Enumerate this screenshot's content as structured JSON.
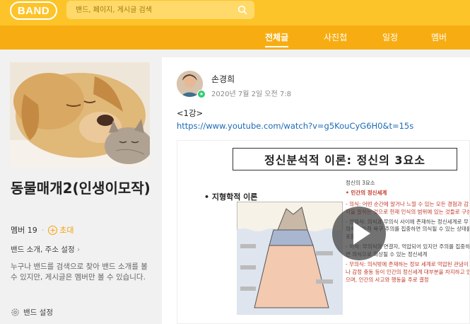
{
  "header": {
    "logo_text": "BAND",
    "search_placeholder": "밴드, 페이지, 게시글 검색",
    "brand_color": "#fdc42a",
    "tab_bar_color": "#f7ad12"
  },
  "tabs": [
    {
      "label": "전체글",
      "active": true
    },
    {
      "label": "사진첩",
      "active": false
    },
    {
      "label": "일정",
      "active": false
    },
    {
      "label": "멤버",
      "active": false
    }
  ],
  "band": {
    "name": "동물매개2(인생이모작)",
    "members_label": "멤버",
    "members_count": "19",
    "invite_label": "초대",
    "settings_link": "밴드 소개, 주소 설정",
    "description": "누구나 밴드를 검색으로 찾아 밴드 소개를 볼 수 있지만, 게시글은 멤버만 볼 수 있습니다.",
    "band_settings": "밴드 설정"
  },
  "post": {
    "author": "손경희",
    "date": "2020년 7월 2일 오전 7:8",
    "text": "<1강>",
    "link": "https://www.youtube.com/watch?v=g5KouCyG6H0&t=15s",
    "video": {
      "slide_title": "정신분석적 이론: 정신의 3요소",
      "slide_subtitle": "• 지형학적 이론",
      "slide_heading": "정신의 3요소",
      "slide_section": "• 인간의 정신세계",
      "slide_items": [
        "- 의식: 어떤 순간에 알거나 느낄 수 있는 모든 경험과 감각을 말하는 것으로 현재 인식의 범위에 있는 것들로 구성",
        "- 전의식: 의식과 무의식 사이에 존재하는 정신세계로 무의식 본능적 욕구 주의를 집중하면 의식될 수 있는 상태를 포함",
        "- 이식: 무의식의 연결자, 억압되어 있지만 주의를 집중하면 의식으로 회상될 수 있는 정신세계",
        "- 무의식: 의식밖에 존재하는 정보 세계로 억압된 관념이나 감정 충동 등이 인간의 정신세계 대부분을 차지하고 있으며, 인간의 사고와 행동을 주로 결정"
      ]
    }
  }
}
